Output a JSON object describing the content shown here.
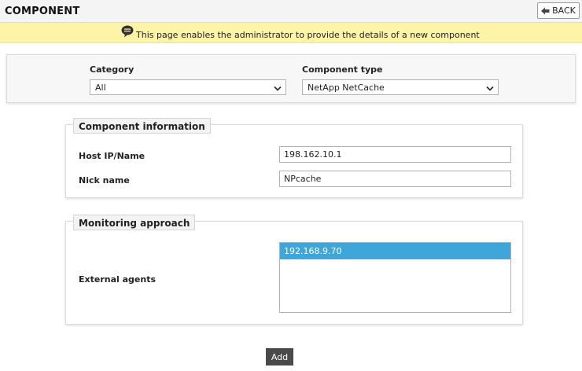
{
  "header": {
    "title": "COMPONENT",
    "back_label": "BACK"
  },
  "info_bar": {
    "message": "This page enables the administrator to provide the details of a new component"
  },
  "selection": {
    "category_label": "Category",
    "category_value": "All",
    "component_type_label": "Component type",
    "component_type_value": "NetApp NetCache"
  },
  "component_information": {
    "legend": "Component information",
    "host_label": "Host IP/Name",
    "host_value": "198.162.10.1",
    "nick_label": "Nick name",
    "nick_value": "NPcache"
  },
  "monitoring": {
    "legend": "Monitoring approach",
    "agents_label": "External agents",
    "agents": [
      "192.168.9.70"
    ]
  },
  "footer": {
    "add_label": "Add"
  },
  "colors": {
    "info_bar": "#fdf4a8",
    "selected_item": "#3fa6d9",
    "add_button": "#4a4a4a"
  },
  "icons": {
    "back": "arrow-left-icon",
    "info": "speech-bubble-icon",
    "dropdown": "chevron-down-icon"
  }
}
